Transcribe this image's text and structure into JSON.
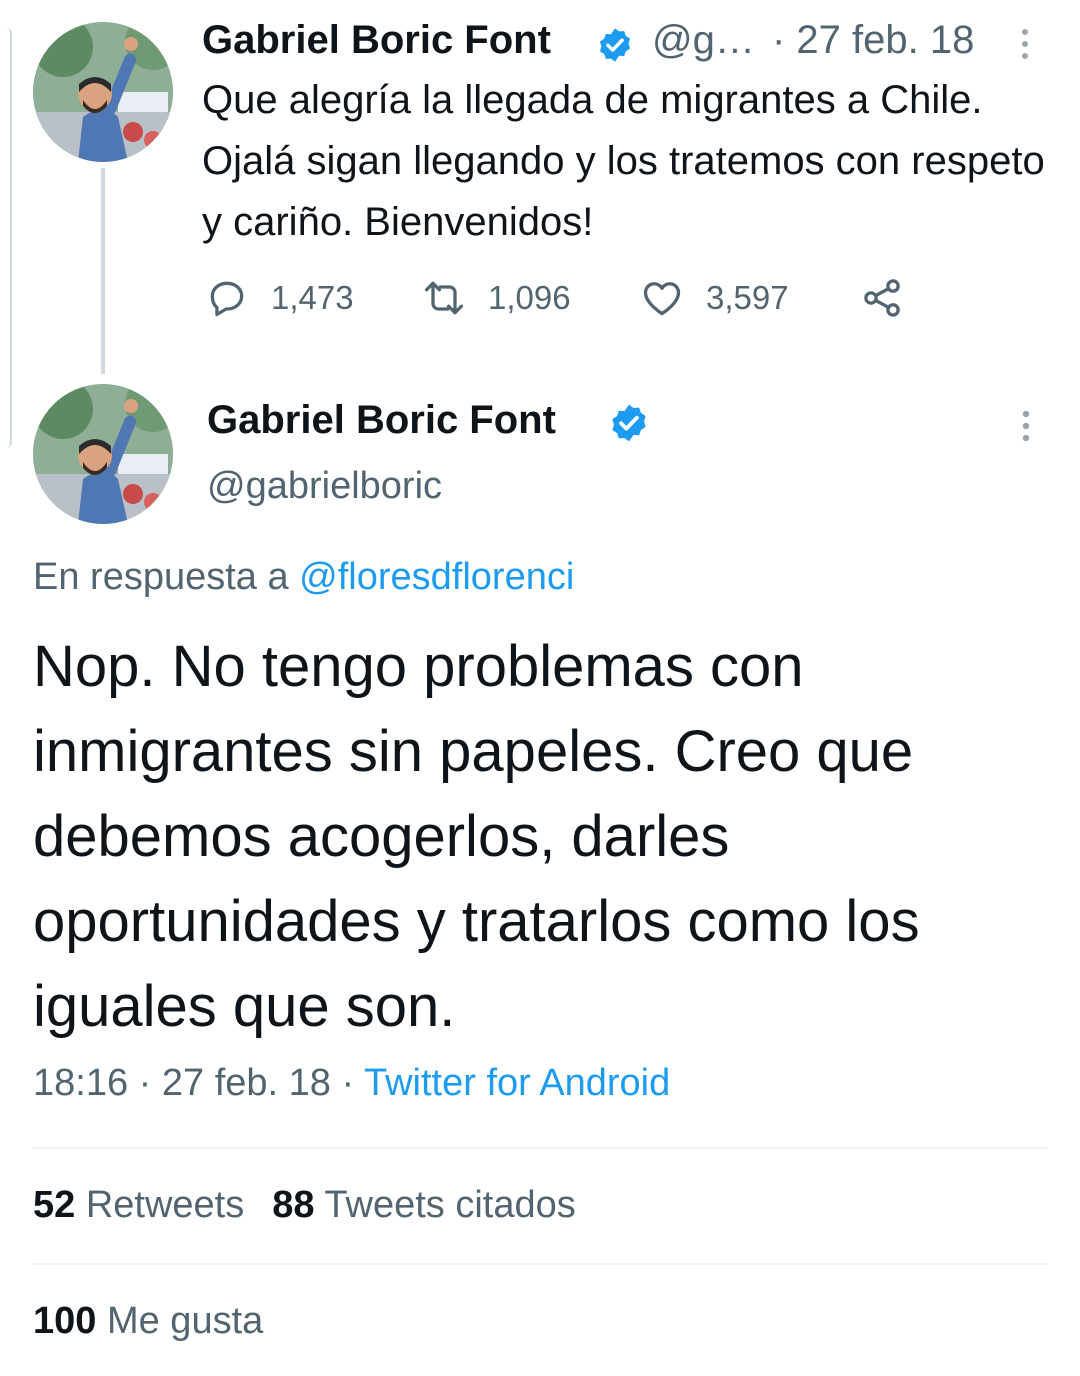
{
  "colors": {
    "text_primary": "#0f1419",
    "text_secondary": "#536471",
    "link": "#1d9bf0",
    "verified_badge": "#1d9bf0",
    "divider": "#eff3f4"
  },
  "parent_tweet": {
    "author_name": "Gabriel Boric Font",
    "handle": "@g…",
    "date": "· 27 feb. 18",
    "text": "Que alegría la llegada de migrantes a Chile. Ojalá sigan llegando y los tratemos con respeto y cariño. Bienvenidos!",
    "actions": {
      "reply_count": "1,473",
      "retweet_count": "1,096",
      "like_count": "3,597",
      "reply_icon": "reply-icon",
      "retweet_icon": "retweet-icon",
      "like_icon": "heart-icon",
      "share_icon": "share-icon"
    }
  },
  "main_tweet": {
    "author_name": "Gabriel Boric Font",
    "handle": "@gabrielboric",
    "reply_prefix": "En respuesta a ",
    "reply_mention": "@floresdflorenci",
    "text": "Nop. No tengo problemas con inmigrantes sin papeles. Creo que debemos acogerlos, darles oportunidades y tratarlos como los iguales que son.",
    "time": "18:16",
    "date": " · 27 feb. 18 · ",
    "source": "Twitter for Android",
    "stats": {
      "retweets_count": "52",
      "retweets_label": " Retweets",
      "quotes_count": "88",
      "quotes_label": " Tweets citados",
      "likes_count": "100",
      "likes_label": " Me gusta"
    }
  }
}
